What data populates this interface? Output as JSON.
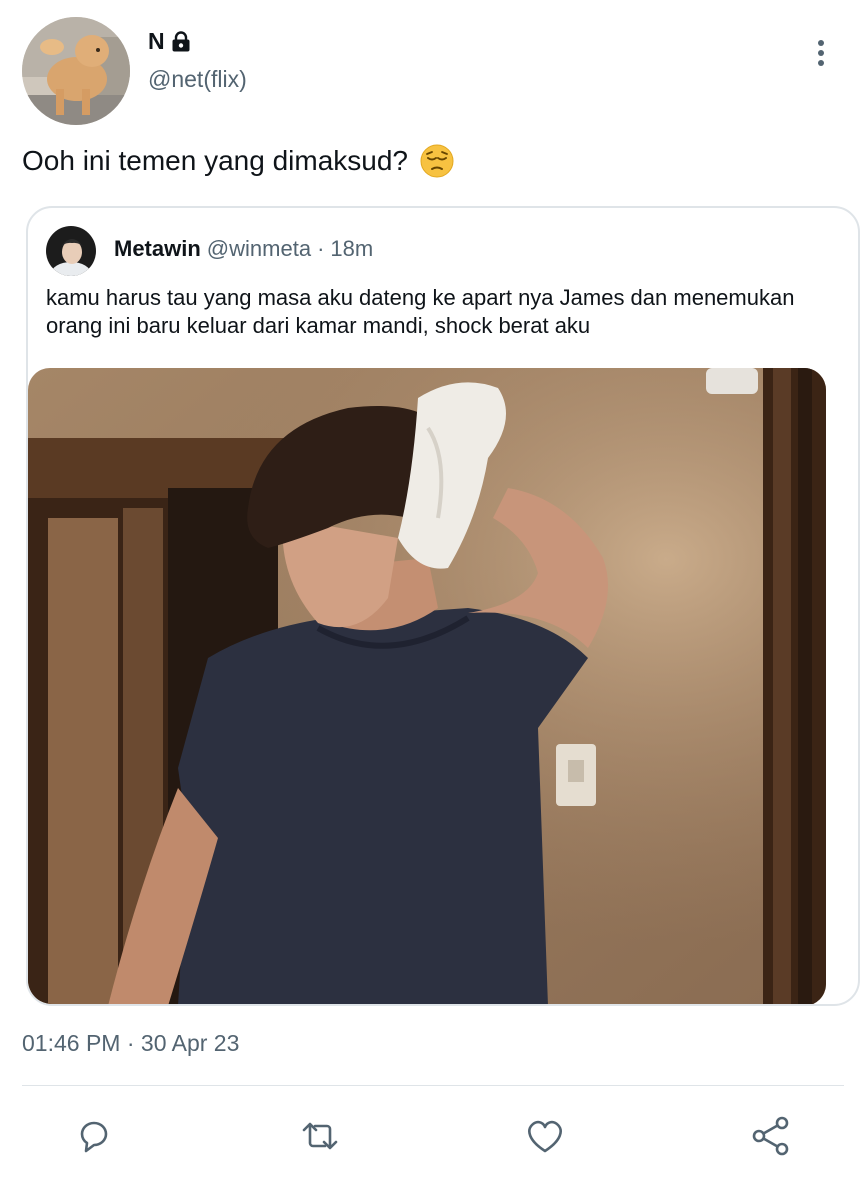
{
  "author": {
    "display_name": "N",
    "handle": "@net(flix)",
    "avatar_icon": "dog-photo-avatar",
    "protected_icon": "lock-icon"
  },
  "tweet": {
    "text": "Ooh ini temen yang dimaksud?",
    "emoji_icon": "pensive-face-emoji"
  },
  "quoted_tweet": {
    "name": "Metawin",
    "handle": "@winmeta",
    "separator": "·",
    "time": "18m",
    "text": "kamu harus tau yang masa aku dateng ke apart nya James dan menemukan orang ini baru keluar dari kamar mandi, shock berat aku",
    "media_icon": "photo-man-drying-hair-with-towel"
  },
  "meta": {
    "time": "01:46 PM",
    "separator": "·",
    "date": "30 Apr 23"
  },
  "actions": {
    "reply_icon": "reply-icon",
    "retweet_icon": "retweet-icon",
    "like_icon": "heart-icon",
    "share_icon": "share-icon"
  },
  "colors": {
    "text_primary": "#0f1419",
    "text_secondary": "#536471",
    "border": "#dfe4e8"
  }
}
